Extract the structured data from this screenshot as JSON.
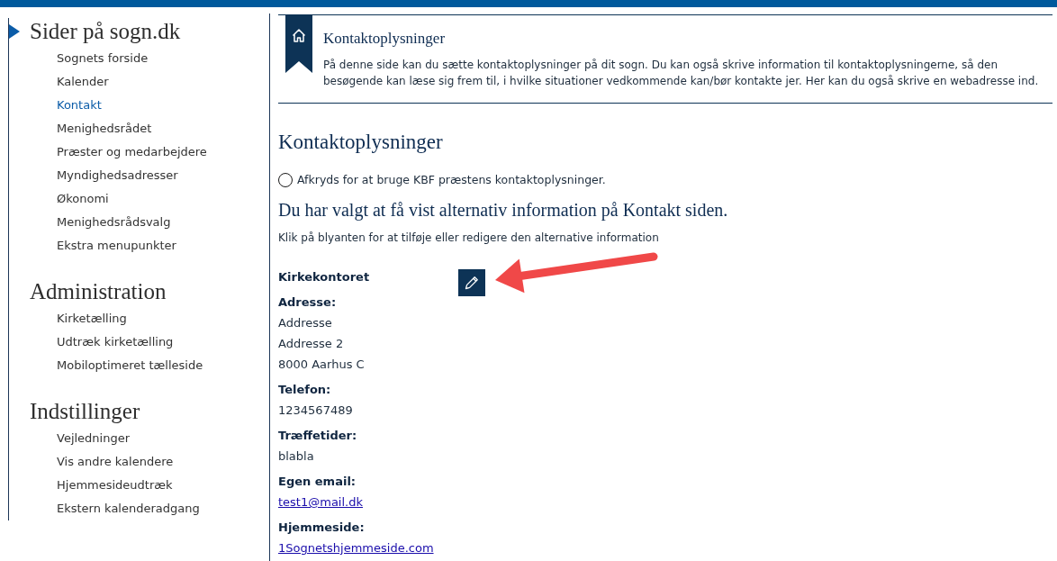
{
  "sidebar": {
    "sections": [
      {
        "heading": "Sider på sogn.dk",
        "selected": true,
        "items": [
          {
            "label": "Sognets forside",
            "selected": false
          },
          {
            "label": "Kalender",
            "selected": false
          },
          {
            "label": "Kontakt",
            "selected": true
          },
          {
            "label": "Menighedsrådet",
            "selected": false
          },
          {
            "label": "Præster og medarbejdere",
            "selected": false
          },
          {
            "label": "Myndighedsadresser",
            "selected": false
          },
          {
            "label": "Økonomi",
            "selected": false
          },
          {
            "label": "Menighedsrådsvalg",
            "selected": false
          },
          {
            "label": "Ekstra menupunkter",
            "selected": false
          }
        ]
      },
      {
        "heading": "Administration",
        "selected": false,
        "items": [
          {
            "label": "Kirketælling",
            "selected": false
          },
          {
            "label": "Udtræk kirketælling",
            "selected": false
          },
          {
            "label": "Mobiloptimeret tælleside",
            "selected": false
          }
        ]
      },
      {
        "heading": "Indstillinger",
        "selected": false,
        "items": [
          {
            "label": "Vejledninger",
            "selected": false
          },
          {
            "label": "Vis andre kalendere",
            "selected": false
          },
          {
            "label": "Hjemmesideudtræk",
            "selected": false
          },
          {
            "label": "Ekstern kalenderadgang",
            "selected": false
          }
        ]
      }
    ]
  },
  "page_header": {
    "title": "Kontaktoplysninger",
    "description": "På denne side kan du sætte kontaktoplysninger på dit sogn. Du kan også skrive information til kontaktoplysningerne, så den besøgende kan læse sig frem til, i hvilke situationer vedkommende kan/bør kontakte jer. Her kan du også skrive en webadresse ind."
  },
  "content": {
    "heading": "Kontaktoplysninger",
    "option": {
      "label": "Afkryds for at bruge KBF præstens kontaktoplysninger.",
      "checked": false
    },
    "notice": "Du har valgt at få vist alternativ information på Kontakt siden.",
    "hint": "Klik på blyanten for at tilføje eller redigere den alternative information",
    "contact": {
      "name": "Kirkekontoret",
      "fields": [
        {
          "label": "Adresse:",
          "lines": [
            {
              "text": "Addresse",
              "kind": "text"
            },
            {
              "text": "Addresse 2",
              "kind": "text"
            },
            {
              "text": "8000 Aarhus C",
              "kind": "text"
            }
          ]
        },
        {
          "label": "Telefon:",
          "lines": [
            {
              "text": "1234567489",
              "kind": "text"
            }
          ]
        },
        {
          "label": "Træffetider:",
          "lines": [
            {
              "text": "blabla",
              "kind": "text"
            }
          ]
        },
        {
          "label": "Egen email:",
          "lines": [
            {
              "text": "test1@mail.dk",
              "kind": "link"
            }
          ]
        },
        {
          "label": "Hjemmeside:",
          "lines": [
            {
              "text": "1Sognetshjemmeside.com",
              "kind": "link"
            }
          ]
        }
      ]
    }
  }
}
